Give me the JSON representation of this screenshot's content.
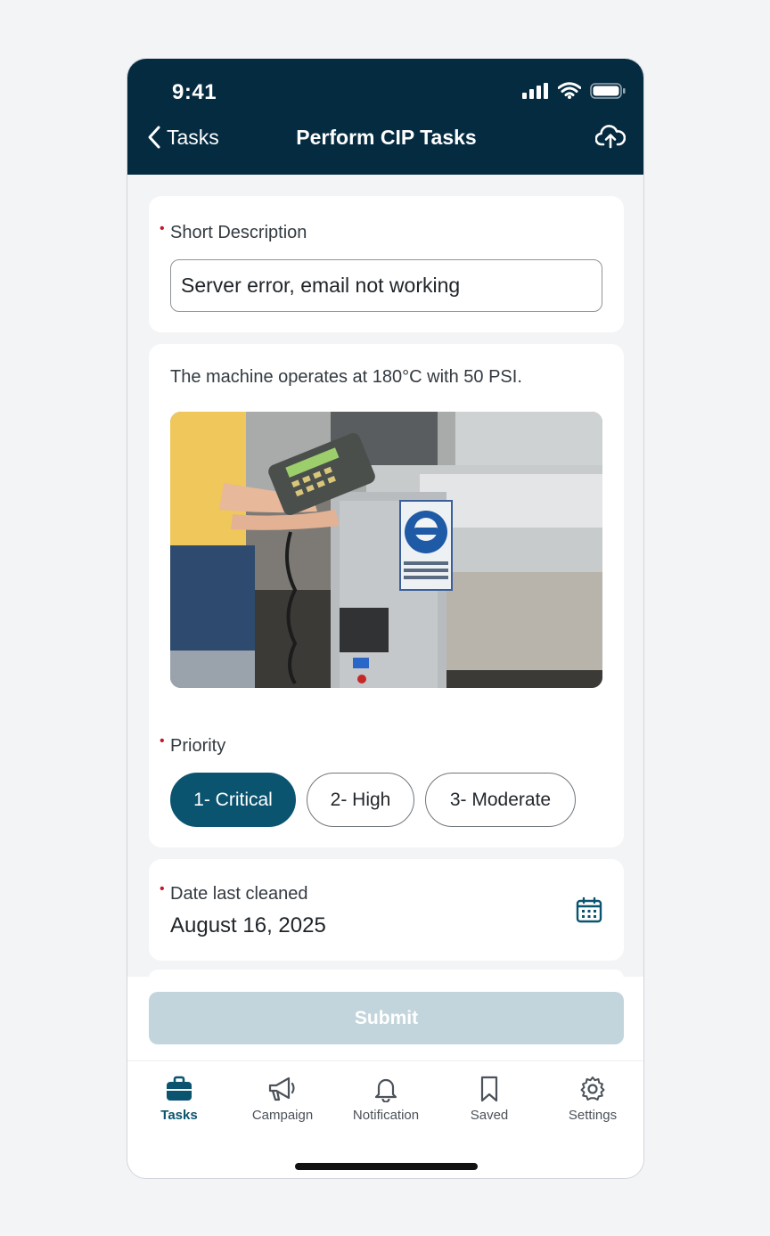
{
  "status_bar": {
    "time": "9:41"
  },
  "nav": {
    "back_label": "Tasks",
    "title": "Perform CIP Tasks"
  },
  "form": {
    "short_description": {
      "label": "Short Description",
      "value": "Server error, email not working"
    },
    "info_text": "The machine operates at 180°C with 50 PSI.",
    "priority": {
      "label": "Priority",
      "options": [
        "1- Critical",
        "2- High",
        "3- Moderate"
      ],
      "selected": "1- Critical"
    },
    "date_last_cleaned": {
      "label": "Date last cleaned",
      "value": "August 16, 2025"
    }
  },
  "submit_label": "Submit",
  "tabs": [
    {
      "label": "Tasks",
      "icon": "briefcase-icon"
    },
    {
      "label": "Campaign",
      "icon": "megaphone-icon"
    },
    {
      "label": "Notification",
      "icon": "bell-icon"
    },
    {
      "label": "Saved",
      "icon": "bookmark-icon"
    },
    {
      "label": "Settings",
      "icon": "gear-icon"
    }
  ],
  "colors": {
    "header": "#052b40",
    "accent": "#0a5470",
    "required": "#c0192c",
    "submit_disabled": "#c3d5dc"
  }
}
